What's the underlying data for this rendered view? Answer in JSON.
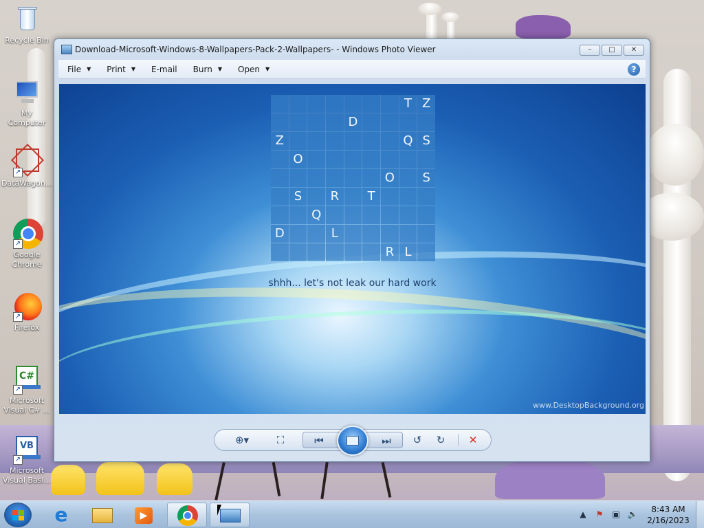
{
  "desktop": {
    "icons": [
      {
        "label": "Recycle Bin",
        "icon": "recycle-bin-icon"
      },
      {
        "label": "My Computer",
        "icon": "computer-icon"
      },
      {
        "label": "DataWagon...",
        "icon": "datawagon-icon"
      },
      {
        "label": "Google Chrome",
        "icon": "chrome-icon"
      },
      {
        "label": "Firefox",
        "icon": "firefox-icon"
      },
      {
        "label": "Microsoft Visual C# ...",
        "icon": "visual-csharp-icon"
      },
      {
        "label": "Microsoft Visual Basi...",
        "icon": "visual-basic-icon"
      }
    ]
  },
  "window": {
    "title": "Download-Microsoft-Windows-8-Wallpapers-Pack-2-Wallpapers- - Windows Photo Viewer",
    "buttons": {
      "minimize": "–",
      "maximize": "□",
      "close": "✕"
    },
    "menu": [
      {
        "label": "File",
        "has_dropdown": true
      },
      {
        "label": "Print",
        "has_dropdown": true
      },
      {
        "label": "E-mail",
        "has_dropdown": false
      },
      {
        "label": "Burn",
        "has_dropdown": true
      },
      {
        "label": "Open",
        "has_dropdown": true
      }
    ],
    "help_label": "?"
  },
  "image": {
    "grid": [
      [
        "",
        "",
        "",
        "",
        "",
        "",
        "",
        "T",
        "Z"
      ],
      [
        "",
        "",
        "",
        "",
        "D",
        "",
        "",
        "",
        ""
      ],
      [
        "Z",
        "",
        "",
        "",
        "",
        "",
        "",
        "Q",
        "S"
      ],
      [
        "",
        "O",
        "",
        "",
        "",
        "",
        "",
        "",
        ""
      ],
      [
        "",
        "",
        "",
        "",
        "",
        "",
        "O",
        "",
        "S"
      ],
      [
        "",
        "S",
        "",
        "R",
        "",
        "T",
        "",
        "",
        ""
      ],
      [
        "",
        "",
        "Q",
        "",
        "",
        "",
        "",
        "",
        ""
      ],
      [
        "D",
        "",
        "",
        "L",
        "",
        "",
        "",
        "",
        ""
      ],
      [
        "",
        "",
        "",
        "",
        "",
        "",
        "R",
        "L",
        ""
      ]
    ],
    "tagline": "shhh... let's not leak our hard work",
    "watermark": "www.DesktopBackground.org"
  },
  "controls": {
    "zoom": "zoom-icon",
    "fit": "actual-size-icon",
    "previous": "previous-icon",
    "slideshow": "slideshow-icon",
    "next": "next-icon",
    "rotate_ccw": "rotate-counterclockwise-icon",
    "rotate_cw": "rotate-clockwise-icon",
    "delete": "delete-icon",
    "accent_color": "#d9261c"
  },
  "taskbar": {
    "items": [
      "internet-explorer-icon",
      "file-explorer-icon",
      "media-player-icon",
      "chrome-icon",
      "photo-viewer-icon"
    ],
    "clock": {
      "time": "8:43 AM",
      "date": "2/16/2023"
    }
  }
}
